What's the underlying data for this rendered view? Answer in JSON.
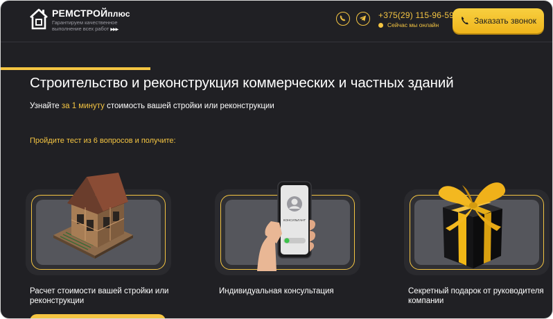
{
  "brand": {
    "name": "РЕМСТРОЙ",
    "name_suffix": "плюс",
    "tagline": "Гарантируем качественное выполнение всех работ",
    "tagline_arrows": "▶▶▶"
  },
  "header": {
    "messengers": [
      "viber-icon",
      "telegram-icon"
    ],
    "phone": "+375(29) 115-96-59",
    "status": "Сейчас мы онлайн",
    "call_button": "Заказать звонок"
  },
  "hero": {
    "title": "Строительство и реконструкция коммерческих и частных зданий",
    "subtitle_before": "Узнайте ",
    "subtitle_highlight": "за 1 минуту",
    "subtitle_after": " стоимость вашей стройки или реконструкции",
    "quiz_note": "Пройдите тест из 6 вопросов и получите:"
  },
  "offers": [
    {
      "icon": "house-render-icon",
      "caption": "Расчет стоимости вашей стройки или реконструкции"
    },
    {
      "icon": "phone-consultant-icon",
      "caption": "Индивидуальная консультация",
      "phone_screen_label": "КОНСУЛЬТАНТ"
    },
    {
      "icon": "gift-box-icon",
      "caption": "Секретный подарок от руководителя компании"
    }
  ],
  "colors": {
    "background": "#202024",
    "accent": "#f5c542",
    "card": "#2a2a2e",
    "text": "#ffffff"
  }
}
